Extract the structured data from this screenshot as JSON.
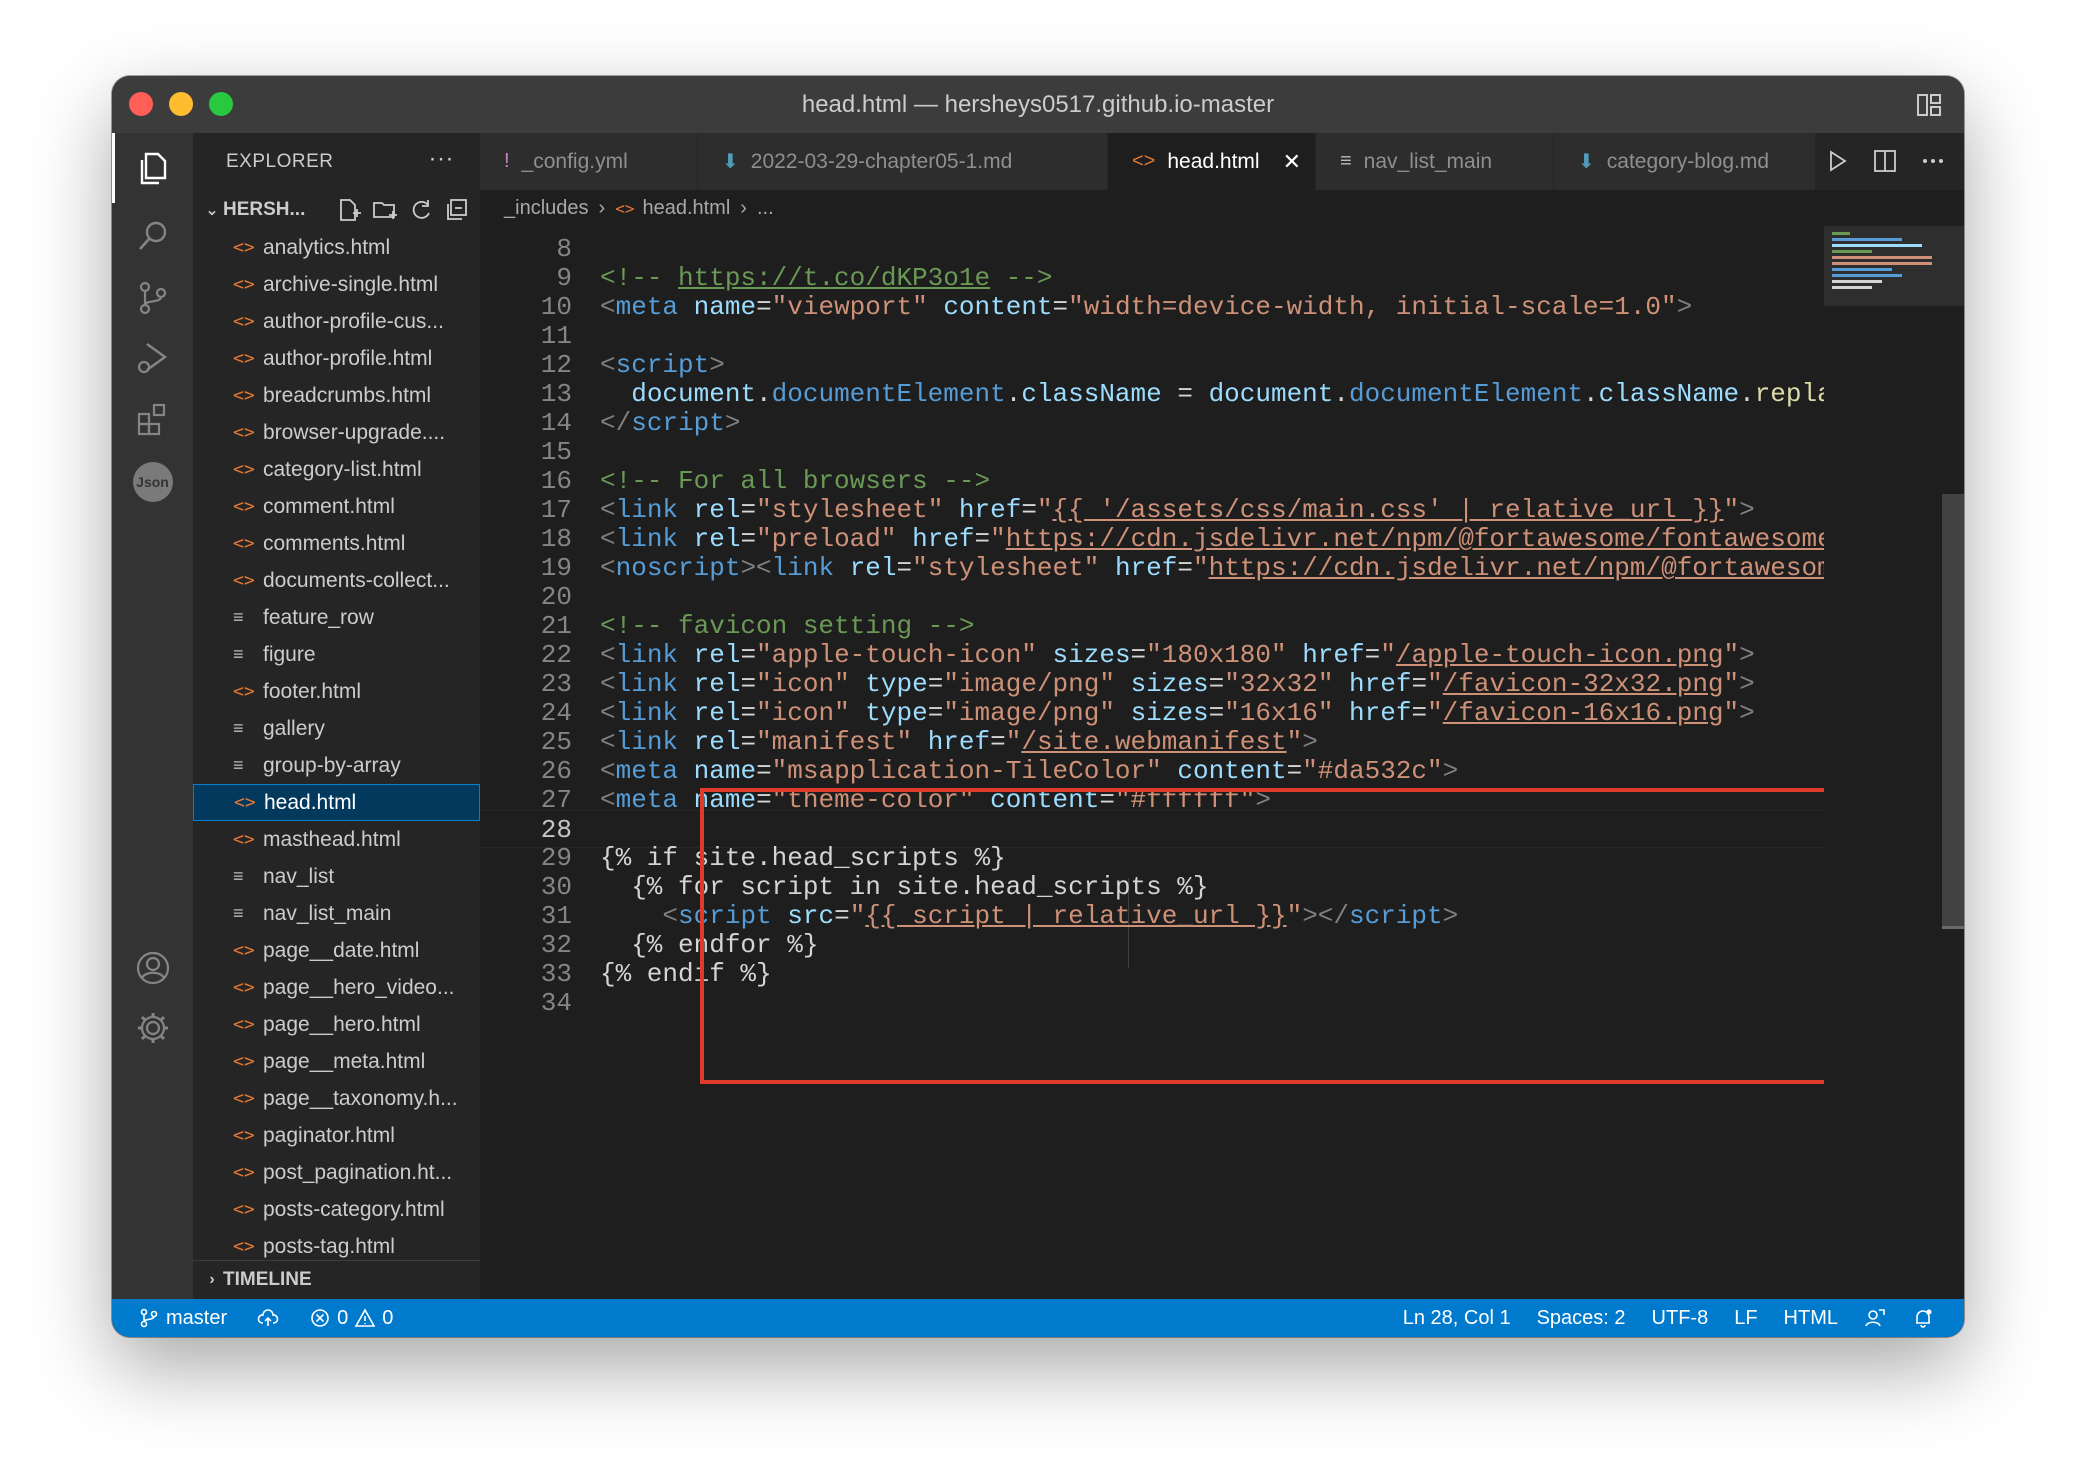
{
  "window": {
    "title": "head.html — hersheys0517.github.io-master"
  },
  "sidebar": {
    "header": "EXPLORER",
    "more": "···",
    "folder": "HERSH...",
    "files": [
      {
        "name": "analytics.html",
        "kind": "html"
      },
      {
        "name": "archive-single.html",
        "kind": "html"
      },
      {
        "name": "author-profile-cus...",
        "kind": "html"
      },
      {
        "name": "author-profile.html",
        "kind": "html"
      },
      {
        "name": "breadcrumbs.html",
        "kind": "html"
      },
      {
        "name": "browser-upgrade....",
        "kind": "html"
      },
      {
        "name": "category-list.html",
        "kind": "html"
      },
      {
        "name": "comment.html",
        "kind": "html"
      },
      {
        "name": "comments.html",
        "kind": "html"
      },
      {
        "name": "documents-collect...",
        "kind": "html"
      },
      {
        "name": "feature_row",
        "kind": "text"
      },
      {
        "name": "figure",
        "kind": "text"
      },
      {
        "name": "footer.html",
        "kind": "html"
      },
      {
        "name": "gallery",
        "kind": "text"
      },
      {
        "name": "group-by-array",
        "kind": "text"
      },
      {
        "name": "head.html",
        "kind": "html",
        "active": true
      },
      {
        "name": "masthead.html",
        "kind": "html"
      },
      {
        "name": "nav_list",
        "kind": "text"
      },
      {
        "name": "nav_list_main",
        "kind": "text"
      },
      {
        "name": "page__date.html",
        "kind": "html"
      },
      {
        "name": "page__hero_video...",
        "kind": "html"
      },
      {
        "name": "page__hero.html",
        "kind": "html"
      },
      {
        "name": "page__meta.html",
        "kind": "html"
      },
      {
        "name": "page__taxonomy.h...",
        "kind": "html"
      },
      {
        "name": "paginator.html",
        "kind": "html"
      },
      {
        "name": "post_pagination.ht...",
        "kind": "html"
      },
      {
        "name": "posts-category.html",
        "kind": "html"
      },
      {
        "name": "posts-tag.html",
        "kind": "html"
      }
    ],
    "timeline": "TIMELINE"
  },
  "tabs": [
    {
      "label": "_config.yml",
      "icon": "!",
      "icon_color": "#c586c0",
      "width": 218
    },
    {
      "label": "2022-03-29-chapter05-1.md",
      "icon": "⬇",
      "icon_color": "#519aba",
      "width": 410
    },
    {
      "label": "head.html",
      "icon": "<>",
      "icon_color": "#e37933",
      "active": true,
      "close": "✕",
      "width": 208
    },
    {
      "label": "nav_list_main",
      "icon": "≡",
      "icon_color": "#bbbbbb",
      "width": 238
    },
    {
      "label": "category-blog.md",
      "icon": "⬇",
      "icon_color": "#519aba",
      "width": 262
    }
  ],
  "breadcrumb": {
    "folder": "_includes",
    "file": "head.html",
    "more": "..."
  },
  "editor": {
    "lines": [
      {
        "n": "8",
        "t": []
      },
      {
        "n": "9",
        "t": [
          [
            "c",
            "<!-- "
          ],
          [
            "cu",
            "https://t.co/dKP3o1e"
          ],
          [
            "c",
            " -->"
          ]
        ]
      },
      {
        "n": "10",
        "t": [
          [
            "p",
            "<"
          ],
          [
            "tag",
            "meta"
          ],
          [
            "t",
            " "
          ],
          [
            "a",
            "name"
          ],
          [
            "t",
            "="
          ],
          [
            "v",
            "\"viewport\""
          ],
          [
            "t",
            " "
          ],
          [
            "a",
            "content"
          ],
          [
            "t",
            "="
          ],
          [
            "v",
            "\"width=device-width, initial-scale=1.0\""
          ],
          [
            "p",
            ">"
          ]
        ]
      },
      {
        "n": "11",
        "t": []
      },
      {
        "n": "12",
        "t": [
          [
            "p",
            "<"
          ],
          [
            "tag",
            "script"
          ],
          [
            "p",
            ">"
          ]
        ]
      },
      {
        "n": "13",
        "t": [
          [
            "t",
            "  "
          ],
          [
            "a",
            "document"
          ],
          [
            "t",
            "."
          ],
          [
            "tag",
            "documentElement"
          ],
          [
            "t",
            "."
          ],
          [
            "a",
            "className"
          ],
          [
            "t",
            " = "
          ],
          [
            "a",
            "document"
          ],
          [
            "t",
            "."
          ],
          [
            "tag",
            "documentElement"
          ],
          [
            "t",
            "."
          ],
          [
            "a",
            "className"
          ],
          [
            "t",
            "."
          ],
          [
            "f",
            "replace"
          ],
          [
            "t",
            "("
          ],
          [
            "v",
            "/"
          ]
        ]
      },
      {
        "n": "14",
        "t": [
          [
            "p",
            "</"
          ],
          [
            "tag",
            "script"
          ],
          [
            "p",
            ">"
          ]
        ]
      },
      {
        "n": "15",
        "t": []
      },
      {
        "n": "16",
        "t": [
          [
            "c",
            "<!-- For all browsers -->"
          ]
        ]
      },
      {
        "n": "17",
        "t": [
          [
            "p",
            "<"
          ],
          [
            "tag",
            "link"
          ],
          [
            "t",
            " "
          ],
          [
            "a",
            "rel"
          ],
          [
            "t",
            "="
          ],
          [
            "v",
            "\"stylesheet\""
          ],
          [
            "t",
            " "
          ],
          [
            "a",
            "href"
          ],
          [
            "t",
            "="
          ],
          [
            "v",
            "\""
          ],
          [
            "vu",
            "{{ '/assets/css/main.css' | relative_url }}"
          ],
          [
            "v",
            "\""
          ],
          [
            "p",
            ">"
          ]
        ]
      },
      {
        "n": "18",
        "t": [
          [
            "p",
            "<"
          ],
          [
            "tag",
            "link"
          ],
          [
            "t",
            " "
          ],
          [
            "a",
            "rel"
          ],
          [
            "t",
            "="
          ],
          [
            "v",
            "\"preload\""
          ],
          [
            "t",
            " "
          ],
          [
            "a",
            "href"
          ],
          [
            "t",
            "="
          ],
          [
            "v",
            "\""
          ],
          [
            "vu",
            "https://cdn.jsdelivr.net/npm/@fortawesome/fontawesome-fre"
          ]
        ]
      },
      {
        "n": "19",
        "t": [
          [
            "p",
            "<"
          ],
          [
            "tag",
            "noscript"
          ],
          [
            "p",
            "><"
          ],
          [
            "tag",
            "link"
          ],
          [
            "t",
            " "
          ],
          [
            "a",
            "rel"
          ],
          [
            "t",
            "="
          ],
          [
            "v",
            "\"stylesheet\""
          ],
          [
            "t",
            " "
          ],
          [
            "a",
            "href"
          ],
          [
            "t",
            "="
          ],
          [
            "v",
            "\""
          ],
          [
            "vu",
            "https://cdn.jsdelivr.net/npm/@fortawesome/fo"
          ]
        ]
      },
      {
        "n": "20",
        "t": []
      },
      {
        "n": "21",
        "t": [
          [
            "c",
            "<!-- favicon setting -->"
          ]
        ]
      },
      {
        "n": "22",
        "t": [
          [
            "p",
            "<"
          ],
          [
            "tag",
            "link"
          ],
          [
            "t",
            " "
          ],
          [
            "a",
            "rel"
          ],
          [
            "t",
            "="
          ],
          [
            "v",
            "\"apple-touch-icon\""
          ],
          [
            "t",
            " "
          ],
          [
            "a",
            "sizes"
          ],
          [
            "t",
            "="
          ],
          [
            "v",
            "\"180x180\""
          ],
          [
            "t",
            " "
          ],
          [
            "a",
            "href"
          ],
          [
            "t",
            "="
          ],
          [
            "v",
            "\""
          ],
          [
            "vu",
            "/apple-touch-icon.png"
          ],
          [
            "v",
            "\""
          ],
          [
            "p",
            ">"
          ]
        ]
      },
      {
        "n": "23",
        "t": [
          [
            "p",
            "<"
          ],
          [
            "tag",
            "link"
          ],
          [
            "t",
            " "
          ],
          [
            "a",
            "rel"
          ],
          [
            "t",
            "="
          ],
          [
            "v",
            "\"icon\""
          ],
          [
            "t",
            " "
          ],
          [
            "a",
            "type"
          ],
          [
            "t",
            "="
          ],
          [
            "v",
            "\"image/png\""
          ],
          [
            "t",
            " "
          ],
          [
            "a",
            "sizes"
          ],
          [
            "t",
            "="
          ],
          [
            "v",
            "\"32x32\""
          ],
          [
            "t",
            " "
          ],
          [
            "a",
            "href"
          ],
          [
            "t",
            "="
          ],
          [
            "v",
            "\""
          ],
          [
            "vu",
            "/favicon-32x32.png"
          ],
          [
            "v",
            "\""
          ],
          [
            "p",
            ">"
          ]
        ]
      },
      {
        "n": "24",
        "t": [
          [
            "p",
            "<"
          ],
          [
            "tag",
            "link"
          ],
          [
            "t",
            " "
          ],
          [
            "a",
            "rel"
          ],
          [
            "t",
            "="
          ],
          [
            "v",
            "\"icon\""
          ],
          [
            "t",
            " "
          ],
          [
            "a",
            "type"
          ],
          [
            "t",
            "="
          ],
          [
            "v",
            "\"image/png\""
          ],
          [
            "t",
            " "
          ],
          [
            "a",
            "sizes"
          ],
          [
            "t",
            "="
          ],
          [
            "v",
            "\"16x16\""
          ],
          [
            "t",
            " "
          ],
          [
            "a",
            "href"
          ],
          [
            "t",
            "="
          ],
          [
            "v",
            "\""
          ],
          [
            "vu",
            "/favicon-16x16.png"
          ],
          [
            "v",
            "\""
          ],
          [
            "p",
            ">"
          ]
        ]
      },
      {
        "n": "25",
        "t": [
          [
            "p",
            "<"
          ],
          [
            "tag",
            "link"
          ],
          [
            "t",
            " "
          ],
          [
            "a",
            "rel"
          ],
          [
            "t",
            "="
          ],
          [
            "v",
            "\"manifest\""
          ],
          [
            "t",
            " "
          ],
          [
            "a",
            "href"
          ],
          [
            "t",
            "="
          ],
          [
            "v",
            "\""
          ],
          [
            "vu",
            "/site.webmanifest"
          ],
          [
            "v",
            "\""
          ],
          [
            "p",
            ">"
          ]
        ]
      },
      {
        "n": "26",
        "t": [
          [
            "p",
            "<"
          ],
          [
            "tag",
            "meta"
          ],
          [
            "t",
            " "
          ],
          [
            "a",
            "name"
          ],
          [
            "t",
            "="
          ],
          [
            "v",
            "\"msapplication-TileColor\""
          ],
          [
            "t",
            " "
          ],
          [
            "a",
            "content"
          ],
          [
            "t",
            "="
          ],
          [
            "v",
            "\"#da532c\""
          ],
          [
            "p",
            ">"
          ]
        ]
      },
      {
        "n": "27",
        "t": [
          [
            "p",
            "<"
          ],
          [
            "tag",
            "meta"
          ],
          [
            "t",
            " "
          ],
          [
            "a",
            "name"
          ],
          [
            "t",
            "="
          ],
          [
            "v",
            "\"theme-color\""
          ],
          [
            "t",
            " "
          ],
          [
            "a",
            "content"
          ],
          [
            "t",
            "="
          ],
          [
            "v",
            "\"#ffffff\""
          ],
          [
            "p",
            ">"
          ]
        ]
      },
      {
        "n": "28",
        "t": [],
        "current": true
      },
      {
        "n": "29",
        "t": [
          [
            "t",
            "{% if site.head_scripts %}"
          ]
        ]
      },
      {
        "n": "30",
        "t": [
          [
            "t",
            "  {% for script in site.head_scripts %}"
          ]
        ]
      },
      {
        "n": "31",
        "t": [
          [
            "t",
            "    "
          ],
          [
            "p",
            "<"
          ],
          [
            "tag",
            "script"
          ],
          [
            "t",
            " "
          ],
          [
            "a",
            "src"
          ],
          [
            "t",
            "="
          ],
          [
            "v",
            "\""
          ],
          [
            "vu",
            "{{ script | relative_url }}"
          ],
          [
            "v",
            "\""
          ],
          [
            "p",
            "></"
          ],
          [
            "tag",
            "script"
          ],
          [
            "p",
            ">"
          ]
        ]
      },
      {
        "n": "32",
        "t": [
          [
            "t",
            "  {% endfor %}"
          ]
        ]
      },
      {
        "n": "33",
        "t": [
          [
            "t",
            "{% endif %}"
          ]
        ]
      },
      {
        "n": "34",
        "t": []
      }
    ]
  },
  "statusbar": {
    "branch": "master",
    "errors": "0",
    "warnings": "0",
    "position": "Ln 28, Col 1",
    "spaces": "Spaces: 2",
    "encoding": "UTF-8",
    "eol": "LF",
    "language": "HTML"
  },
  "colors": {
    "status_bar": "#007acc",
    "highlight_box": "#e03a2a",
    "active_file": "#04395e"
  }
}
